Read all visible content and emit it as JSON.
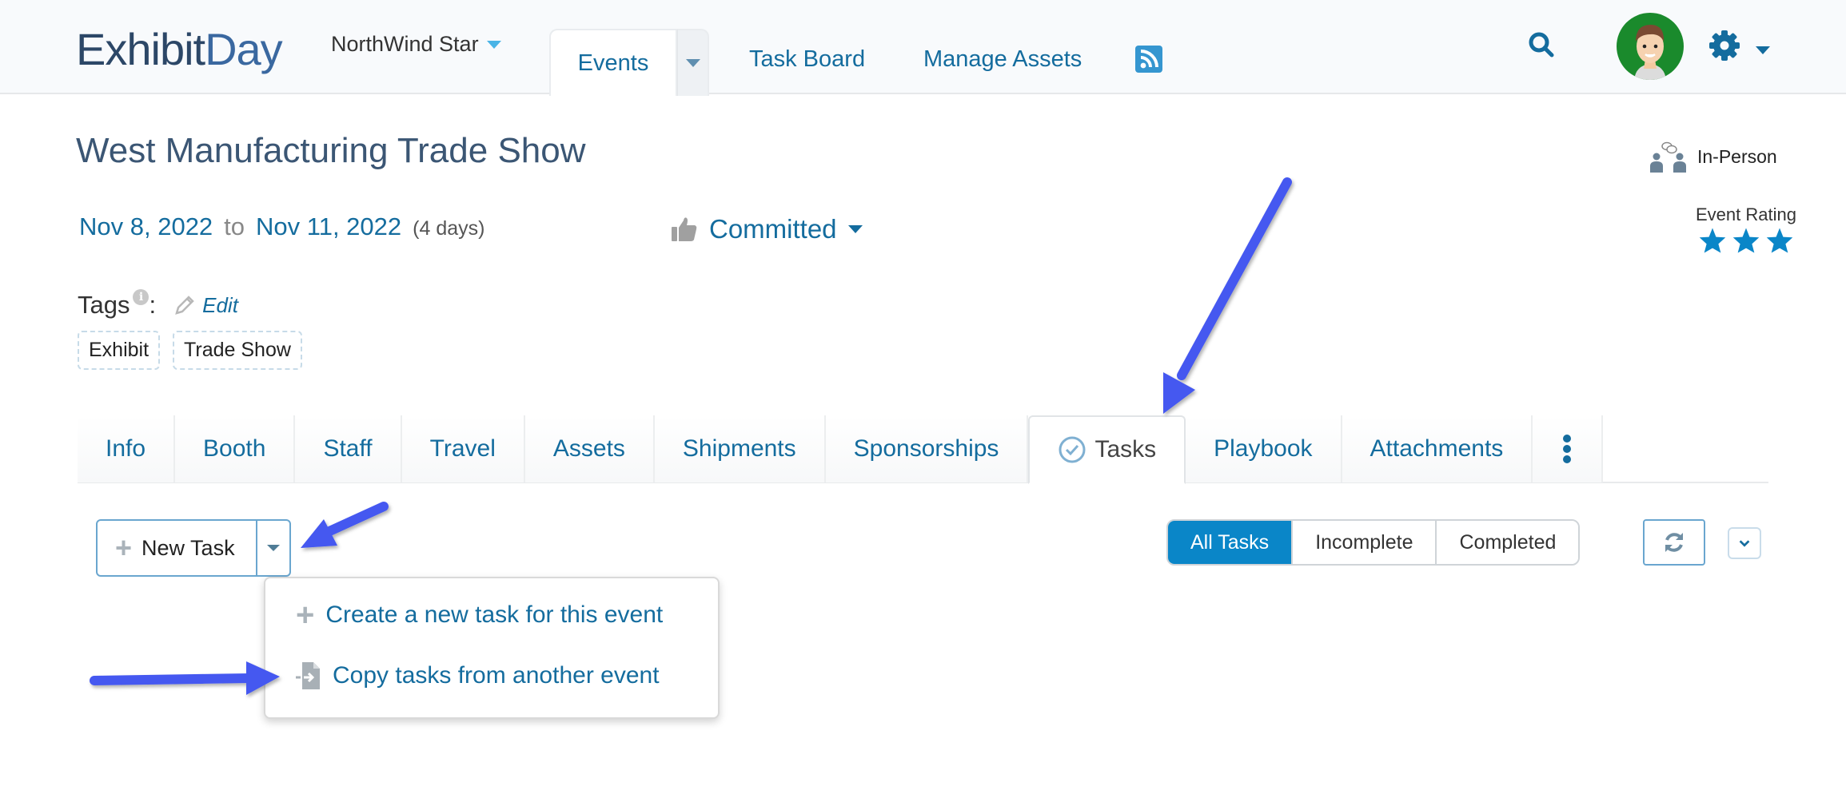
{
  "app": {
    "logo_part1": "Exhibit",
    "logo_part2": "Day",
    "org_name": "NorthWind Star"
  },
  "nav": {
    "items": [
      {
        "label": "Events",
        "active": true,
        "icon": "caret-down-icon"
      },
      {
        "label": "Task Board"
      },
      {
        "label": "Manage Assets"
      }
    ],
    "icons": [
      "rss-icon",
      "search-icon",
      "avatar",
      "gear-icon"
    ]
  },
  "event": {
    "title": "West Manufacturing Trade Show",
    "start_date": "Nov 8, 2022",
    "to_label": "to",
    "end_date": "Nov 11, 2022",
    "duration": "(4 days)",
    "status": "Committed",
    "format": "In-Person",
    "rating_label": "Event Rating",
    "rating": 3,
    "rating_max": 3
  },
  "tags": {
    "label": "Tags",
    "colon": ":",
    "edit_label": "Edit",
    "items": [
      "Exhibit",
      "Trade Show"
    ]
  },
  "tabs": [
    {
      "label": "Info"
    },
    {
      "label": "Booth"
    },
    {
      "label": "Staff"
    },
    {
      "label": "Travel"
    },
    {
      "label": "Assets"
    },
    {
      "label": "Shipments"
    },
    {
      "label": "Sponsorships"
    },
    {
      "label": "Tasks",
      "active": true
    },
    {
      "label": "Playbook"
    },
    {
      "label": "Attachments"
    }
  ],
  "tasks": {
    "new_task_label": "New Task",
    "menu": [
      {
        "label": "Create a new task for this event",
        "icon": "plus-icon"
      },
      {
        "label": "Copy tasks from another event",
        "icon": "file-import-icon"
      }
    ],
    "filters": [
      {
        "label": "All Tasks",
        "active": true
      },
      {
        "label": "Incomplete"
      },
      {
        "label": "Completed"
      }
    ]
  },
  "colors": {
    "link": "#146c9e",
    "primary": "#0a86c8",
    "annotation_arrow": "#4458f0",
    "avatar_bg": "#1a8a2c"
  }
}
